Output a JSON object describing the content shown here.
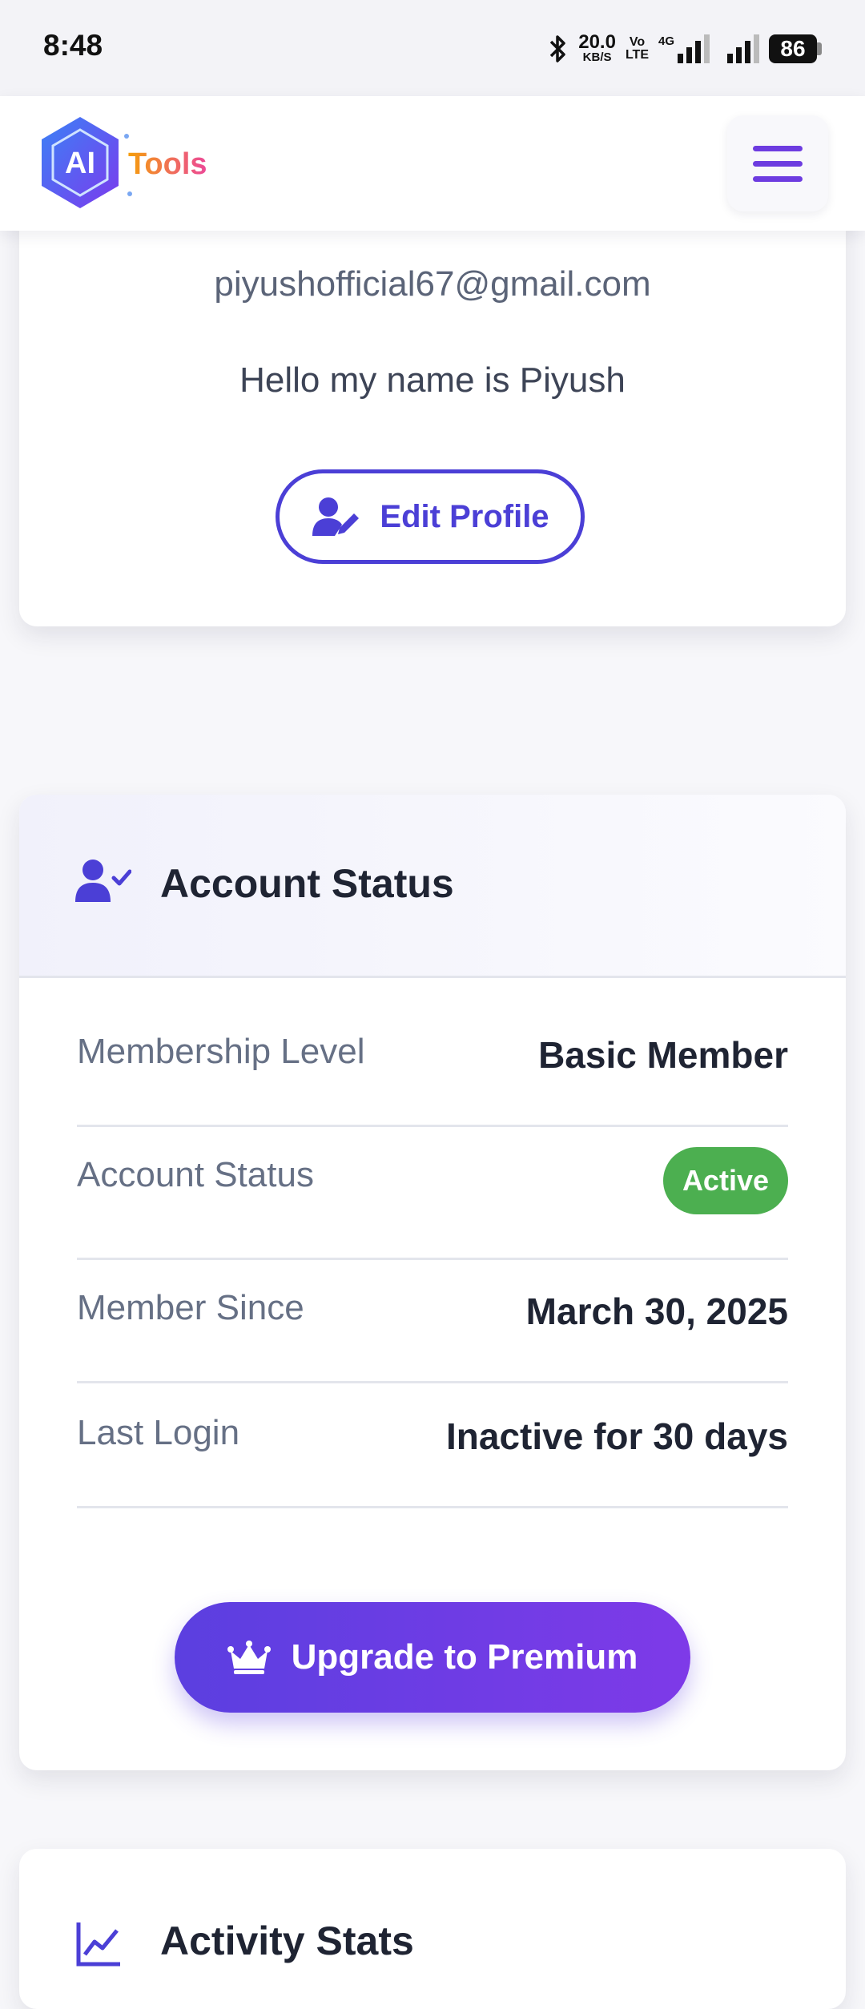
{
  "status_bar": {
    "time": "8:48",
    "net_speed": "20.0",
    "net_unit": "KB/S",
    "volte_top": "Vo",
    "volte_bottom": "LTE",
    "network": "4G",
    "battery": "86"
  },
  "header": {
    "logo_badge": "AI",
    "logo_text": "Tools"
  },
  "profile": {
    "email": "piyushofficial67@gmail.com",
    "bio": "Hello my name is Piyush",
    "edit_button": "Edit Profile"
  },
  "account_status": {
    "title": "Account Status",
    "rows": [
      {
        "label": "Membership Level",
        "value": "Basic Member"
      },
      {
        "label": "Account Status",
        "value": "Active"
      },
      {
        "label": "Member Since",
        "value": "March 30, 2025"
      },
      {
        "label": "Last Login",
        "value": "Inactive for 30 days"
      }
    ],
    "upgrade_button": "Upgrade to Premium"
  },
  "activity": {
    "title": "Activity Stats"
  },
  "colors": {
    "accent": "#4b3fd6",
    "accent_purple": "#6d3ce0",
    "active_badge": "#4caf50"
  },
  "icons": {
    "status_bluetooth": "bluetooth-icon",
    "menu": "hamburger-menu-icon",
    "edit": "user-edit-icon",
    "account": "user-check-icon",
    "premium": "crown-icon",
    "activity": "chart-line-icon"
  }
}
